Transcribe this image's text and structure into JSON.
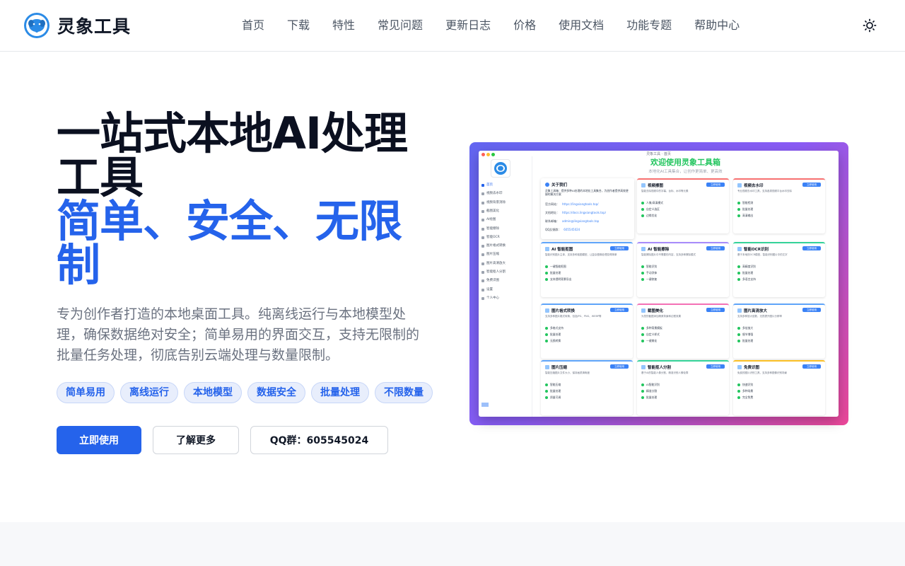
{
  "brand": {
    "name": "灵象工具"
  },
  "nav": [
    "首页",
    "下载",
    "特性",
    "常见问题",
    "更新日志",
    "价格",
    "使用文档",
    "功能专题",
    "帮助中心"
  ],
  "hero": {
    "title_line1": "一站式本地AI处理工具",
    "title_line2": "简单、安全、无限制",
    "description": "专为创作者打造的本地桌面工具。纯离线运行与本地模型处理，确保数据绝对安全；简单易用的界面交互，支持无限制的批量任务处理，彻底告别云端处理与数量限制。",
    "tags": [
      "简单易用",
      "离线运行",
      "本地模型",
      "数据安全",
      "批量处理",
      "不限数量"
    ],
    "buttons": {
      "primary": "立即使用",
      "secondary": "了解更多",
      "qq": "QQ群：605545024"
    }
  },
  "app_preview": {
    "window_title": "灵象工具 · 首页",
    "welcome": "欢迎使用灵象工具箱",
    "subtitle": "本地化AI工具集合，让创作更简单、更高效",
    "sidebar": [
      "首页",
      "视频去水印",
      "视频背景消除",
      "截图美化",
      "AI绘图",
      "智能擦除",
      "智能OCR",
      "图片格式转换",
      "图片压缩",
      "图片高清放大",
      "智能抠人分割",
      "免费识图",
      "设置",
      "个人中心"
    ],
    "about": {
      "title": "关于我们",
      "desc": "灵象工具箱：提供多种AI处理的本地化工具集合，为创作者提供高效便捷的解决方案",
      "rows": [
        {
          "k": "官方网站：",
          "v": "https://lingxiangtools.top/"
        },
        {
          "k": "文档地址：",
          "v": "https://docs.lingxiangtools.top/"
        },
        {
          "k": "联系邮箱：",
          "v": "admin@lingxiangtools.top"
        },
        {
          "k": "QQ反馈群：",
          "v": "605545024"
        }
      ]
    },
    "cards": [
      {
        "title": "视频擦图",
        "btn": "立即使用",
        "desc": "智能去除视频中的字幕、台标、水印等元素",
        "features": [
          "人像/高清模式",
          "自定义选区",
          "边缘优化"
        ]
      },
      {
        "title": "视频去水印",
        "btn": "立即使用",
        "desc": "专业视频去水印工具，支持各类视频平台水印去除",
        "features": [
          "智能检测",
          "批量处理",
          "高清输出"
        ]
      },
      {
        "title": "AI 智能抠图",
        "btn": "立即使用",
        "desc": "智能识别图片主体，支持多种抠图模型，让复杂图像处理变得简单",
        "features": [
          "一键智能抠图",
          "批量处理",
          "支持透明背景导出"
        ]
      },
      {
        "title": "AI 智能擦除",
        "btn": "立即使用",
        "desc": "智能擦除图片中不需要的内容，支持多种擦除模式",
        "features": [
          "智能识别",
          "手动涂抹",
          "一键修复"
        ]
      },
      {
        "title": "智能OCR识别",
        "btn": "立即使用",
        "desc": "基于本地的OCR模型，智能识别图片中的文字",
        "features": [
          "高精度识别",
          "批量处理",
          "多语言支持"
        ]
      },
      {
        "title": "图片格式转换",
        "btn": "立即使用",
        "desc": "支持多种图片格式转换，包括JPG、PNG、WEBP等",
        "features": [
          "多格式支持",
          "批量处理",
          "无损转换"
        ]
      },
      {
        "title": "截图美化",
        "btn": "立即使用",
        "desc": "为您的截图添加精美背景和边框效果",
        "features": [
          "多种背景模板",
          "自定义样式",
          "一键美化"
        ]
      },
      {
        "title": "图片高清放大",
        "btn": "立即使用",
        "desc": "支持多种放大倍数，无损提升图片分辨率",
        "features": [
          "多倍放大",
          "细节增强",
          "批量处理"
        ]
      },
      {
        "title": "图片压缩",
        "btn": "立即使用",
        "desc": "智能压缩图片文件大小，保持画质清晰度",
        "features": [
          "智能压缩",
          "批量处理",
          "质量可调"
        ]
      },
      {
        "title": "智能抠人分割",
        "btn": "立即使用",
        "desc": "基于AI的智能人像分割，精准识别人像轮廓",
        "features": [
          "AI智能识别",
          "精准分割",
          "批量处理"
        ]
      },
      {
        "title": "免费识图",
        "btn": "立即使用",
        "desc": "免费的图片识别工具，支持多种图像识别场景",
        "features": [
          "快速识别",
          "多种场景",
          "完全免费"
        ]
      }
    ]
  },
  "colors": {
    "primary": "#2563eb",
    "accent_green": "#22c55e",
    "gradient_start": "#6366f1",
    "gradient_end": "#ec4899"
  }
}
